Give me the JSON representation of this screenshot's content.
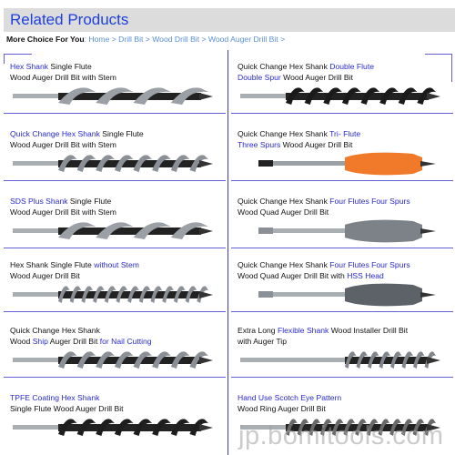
{
  "header": {
    "title": "Related Products"
  },
  "breadcrumb": {
    "lead": "More Choice For You",
    "items": [
      "Home",
      "Drill Bit",
      "Wood Drill Bit",
      "Wood Auger Drill Bit"
    ],
    "separator": ">"
  },
  "products": [
    {
      "parts": [
        {
          "t": "Hex Shank",
          "hl": true
        },
        {
          "t": " Single Flute",
          "hl": false
        }
      ],
      "line2": [
        {
          "t": "Wood Auger Drill Bit with Stem",
          "hl": false
        }
      ],
      "image": "single-flute-auger-bit-with-stem",
      "color": "#9aa0a6"
    },
    {
      "parts": [
        {
          "t": "Quick Change Hex Shank ",
          "hl": false
        },
        {
          "t": "Double Flute",
          "hl": true
        }
      ],
      "line2": [
        {
          "t": "Double Spur",
          "hl": true
        },
        {
          "t": " Wood Auger Drill Bit",
          "hl": false
        }
      ],
      "image": "double-flute-black-auger-bit",
      "color": "#1a1a1a"
    },
    {
      "parts": [
        {
          "t": "Quick Change Hex Shank",
          "hl": true
        },
        {
          "t": " Single Flute",
          "hl": false
        }
      ],
      "line2": [
        {
          "t": "Wood Auger Drill Bit with Stem",
          "hl": false
        }
      ],
      "image": "quick-change-auger-bit",
      "color": "#8a9096"
    },
    {
      "parts": [
        {
          "t": "Quick Change Hex Shank ",
          "hl": false
        },
        {
          "t": "Tri- Flute",
          "hl": true
        }
      ],
      "line2": [
        {
          "t": "Three Spurs",
          "hl": true
        },
        {
          "t": " Wood Auger Drill Bit",
          "hl": false
        }
      ],
      "image": "orange-tri-flute-bit",
      "color": "#f07a2a"
    },
    {
      "parts": [
        {
          "t": "SDS Plus Shank",
          "hl": true
        },
        {
          "t": " Single Flute",
          "hl": false
        }
      ],
      "line2": [
        {
          "t": "Wood Auger Drill Bit with Stem",
          "hl": false
        }
      ],
      "image": "sds-plus-auger-bit",
      "color": "#9aa0a6"
    },
    {
      "parts": [
        {
          "t": "Quick Change Hex Shank ",
          "hl": false
        },
        {
          "t": "Four Flutes Four Spurs",
          "hl": true
        }
      ],
      "line2": [
        {
          "t": "Wood Quad Auger Drill Bit",
          "hl": false
        }
      ],
      "image": "quad-auger-bit",
      "color": "#7c8288"
    },
    {
      "parts": [
        {
          "t": "Hex Shank Single Flute ",
          "hl": false
        },
        {
          "t": "without Stem",
          "hl": true
        }
      ],
      "line2": [
        {
          "t": "Wood Auger Drill Bit",
          "hl": false
        }
      ],
      "image": "long-auger-bit-no-stem",
      "color": "#8a9096"
    },
    {
      "parts": [
        {
          "t": "Quick Change Hex Shank ",
          "hl": false
        },
        {
          "t": "Four Flutes  Four Spurs",
          "hl": true
        }
      ],
      "line2": [
        {
          "t": "Wood Quad Auger Drill Bit with ",
          "hl": false
        },
        {
          "t": "HSS Head",
          "hl": true
        }
      ],
      "image": "quad-auger-bit-hss-head",
      "color": "#5c6268"
    },
    {
      "parts": [
        {
          "t": "Quick Change Hex Shank",
          "hl": false
        }
      ],
      "line2": [
        {
          "t": "Wood ",
          "hl": false
        },
        {
          "t": "Ship",
          "hl": true
        },
        {
          "t": " Auger Drill Bit ",
          "hl": false
        },
        {
          "t": "for Nail Cutting",
          "hl": true
        }
      ],
      "image": "ship-auger-bit",
      "color": "#8a9096"
    },
    {
      "parts": [
        {
          "t": "Extra Long ",
          "hl": false
        },
        {
          "t": "Flexible Shank",
          "hl": true
        },
        {
          "t": " Wood Installer Drill Bit",
          "hl": false
        }
      ],
      "line2": [
        {
          "t": "with Auger Tip",
          "hl": false
        }
      ],
      "image": "flexible-shank-installer-bit",
      "color": "#80868c"
    },
    {
      "parts": [
        {
          "t": "TPFE Coating Hex Shank",
          "hl": true
        }
      ],
      "line2": [
        {
          "t": "Single Flute Wood Auger Drill Bit",
          "hl": false
        }
      ],
      "image": "black-tpfe-auger-bit",
      "color": "#1e1e1e"
    },
    {
      "parts": [
        {
          "t": "Hand Use Scotch Eye Pattern",
          "hl": true
        }
      ],
      "line2": [
        {
          "t": "Wood Ring Auger Drill Bit",
          "hl": false
        }
      ],
      "image": "scotch-eye-ring-auger-bit",
      "color": "#6a6a6a"
    }
  ],
  "watermark": "jp.bomitools.com",
  "colors": {
    "accent": "#1d3fe0",
    "link": "#5a8fd8",
    "highlight": "#2a2ad0",
    "border": "#6060d8"
  }
}
